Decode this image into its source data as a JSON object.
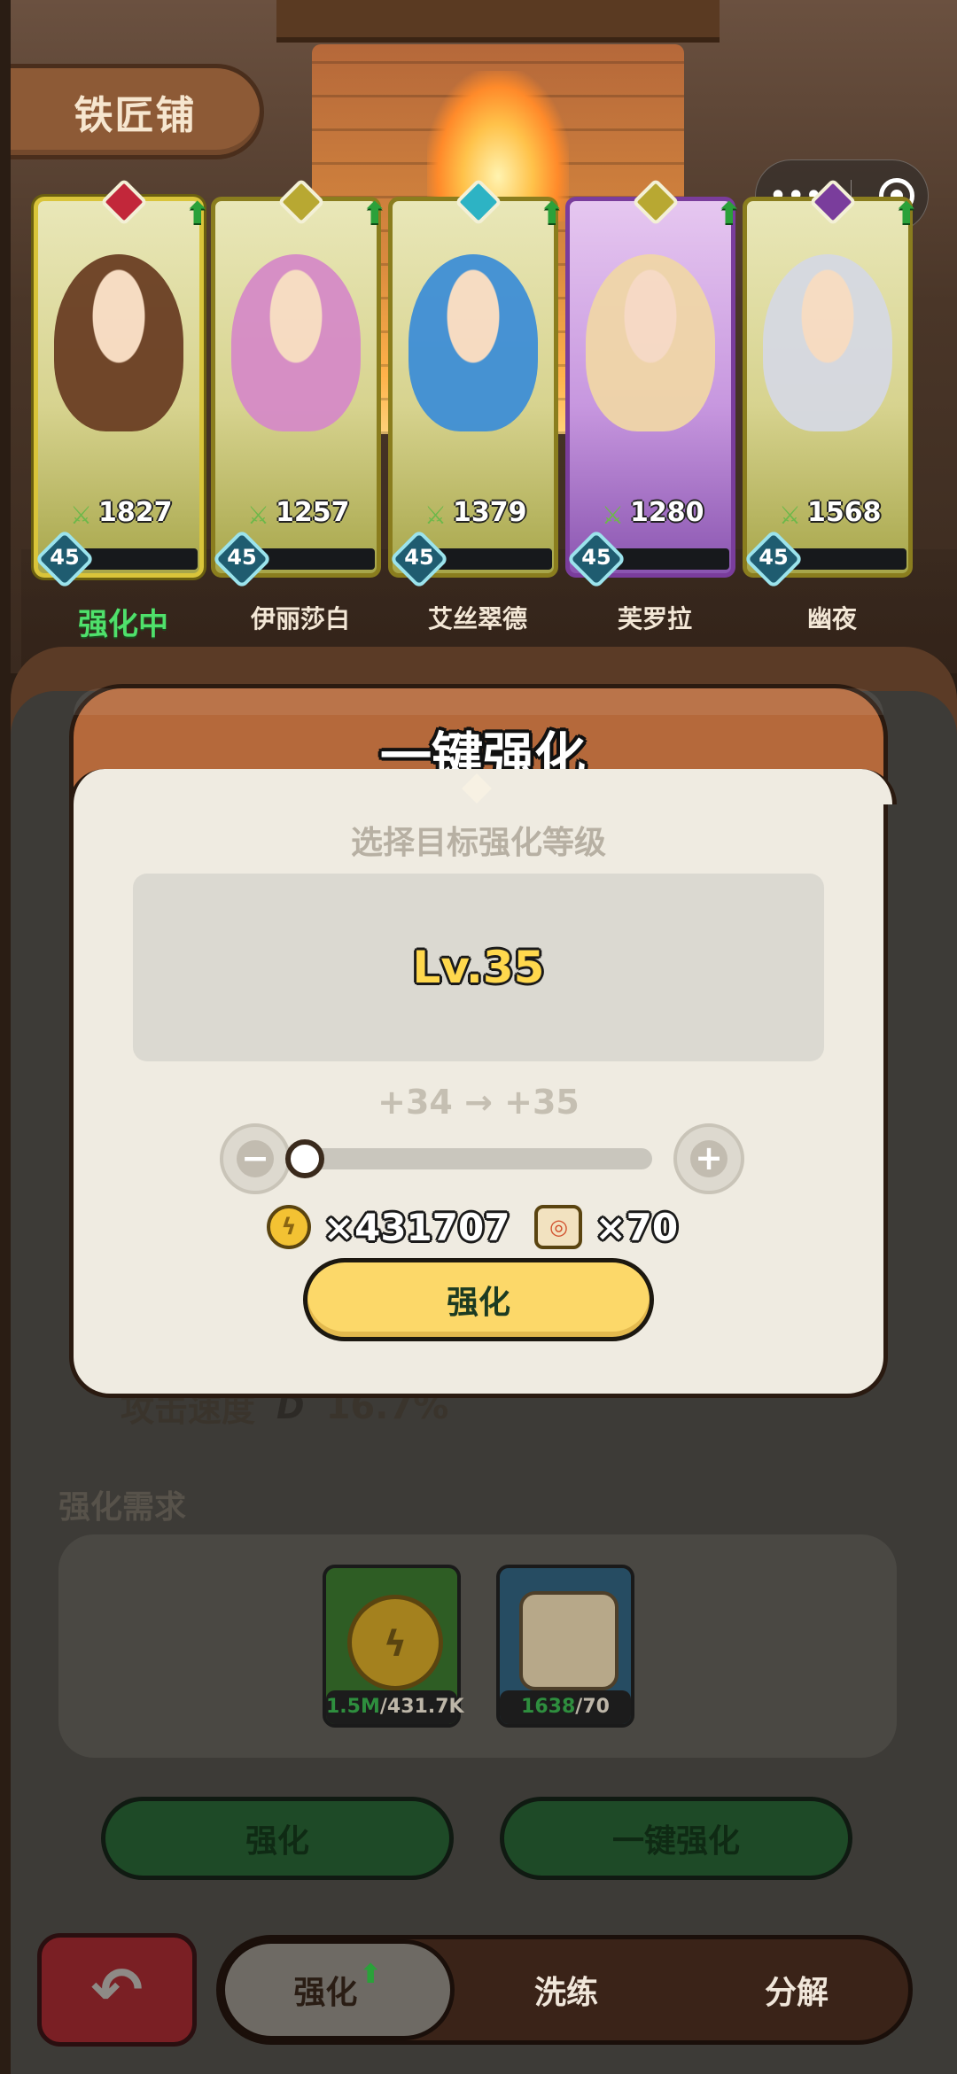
{
  "title": "铁匠铺",
  "capsule": {
    "more": "•••"
  },
  "heroes": [
    {
      "name": "强化中",
      "power": "1827",
      "level": "45",
      "progress": 0.05,
      "selected": true,
      "rarity": "gold",
      "hair": "#6b3f24",
      "emblem": "#c2273a"
    },
    {
      "name": "伊丽莎白",
      "power": "1257",
      "level": "45",
      "progress": 0.05,
      "selected": false,
      "rarity": "gold",
      "hair": "#d68bc7",
      "emblem": "#b8a832"
    },
    {
      "name": "艾丝翠德",
      "power": "1379",
      "level": "45",
      "progress": 0.05,
      "selected": false,
      "rarity": "gold",
      "hair": "#3f8fd6",
      "emblem": "#2db3c4"
    },
    {
      "name": "芙罗拉",
      "power": "1280",
      "level": "45",
      "progress": 0.05,
      "selected": false,
      "rarity": "purple",
      "hair": "#f0d6a8",
      "emblem": "#b8a832"
    },
    {
      "name": "幽夜",
      "power": "1568",
      "level": "45",
      "progress": 0.05,
      "selected": false,
      "rarity": "gold",
      "hair": "#d6d9e2",
      "emblem": "#7a3d9c"
    }
  ],
  "stat": {
    "label": "攻击速度",
    "icon": "D",
    "value": "16.7%"
  },
  "requirements": {
    "title": "强化需求",
    "items": [
      {
        "icon": "coin-icon",
        "have": "1.5M",
        "need": "/431.7K"
      },
      {
        "icon": "scroll-icon",
        "have": "1638",
        "need": "/70"
      }
    ]
  },
  "actions": {
    "enhance": "强化",
    "one_click": "一键强化"
  },
  "tabs": {
    "enhance": "强化",
    "refine": "洗练",
    "dismantle": "分解"
  },
  "modal": {
    "title": "一键强化",
    "subtitle": "选择目标强化等级",
    "level": "Lv.35",
    "range": "+34 → +35",
    "slider": {
      "value": 0
    },
    "costs": {
      "coins": "×431707",
      "scrolls": "×70"
    },
    "confirm": "强化"
  }
}
